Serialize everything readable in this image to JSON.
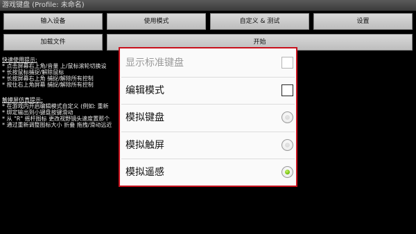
{
  "window": {
    "title": "游戏键盘 (Profile: 未命名)"
  },
  "toolbar": {
    "row1": [
      "输入设备",
      "使用模式",
      "自定义 & 测试",
      "设置"
    ],
    "row2": [
      "加载文件",
      "开始"
    ]
  },
  "help": {
    "quick_heading": "快速使用提示:",
    "quick_lines": [
      "* 点击屏幕右上角/音量 上/鼠标滚轮切换设",
      "* 长按鼠标捕捉/解除鼠标",
      "* 长按屏幕右上角 捕捉/解除所有控制",
      "* 按住右上角屏幕 捕捉/解除所有控制"
    ],
    "touch_heading": "触摸屏仿真提示:",
    "touch_lines": [
      "* 在游戏内开启编辑模式自定义 (例如: 重新",
      "* 绑定输出到小键盘按键滑动",
      "* 从 \"R\" 摇杆图标 更改视野镜头速度置那个",
      "* 通过重新调整图标大小 折叠 拖拽/滑动远近"
    ]
  },
  "dialog": {
    "items": [
      {
        "label": "显示标准键盘",
        "control": "checkbox",
        "checked": false,
        "enabled": false
      },
      {
        "label": "编辑模式",
        "control": "checkbox",
        "checked": false,
        "enabled": true
      },
      {
        "label": "模拟键盘",
        "control": "radio",
        "checked": false,
        "enabled": true
      },
      {
        "label": "模拟触屏",
        "control": "radio",
        "checked": false,
        "enabled": true
      },
      {
        "label": "模拟遥感",
        "control": "radio",
        "checked": true,
        "enabled": true
      }
    ]
  },
  "colors": {
    "dialog_border": "#c8101c",
    "radio_selected": "#79c310",
    "background": "#000000"
  }
}
